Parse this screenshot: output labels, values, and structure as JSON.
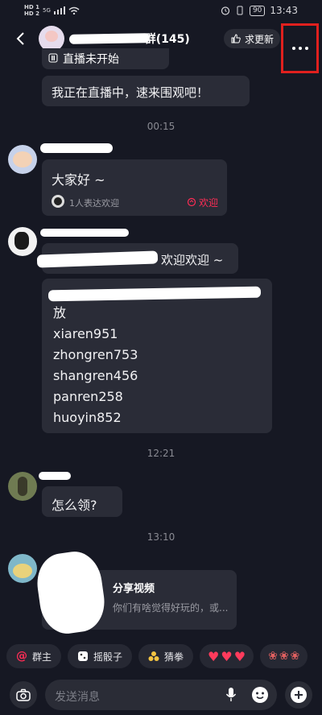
{
  "statusbar": {
    "sim1": "HD 1",
    "sim2": "HD 2",
    "net": "5G",
    "battery": "90",
    "time": "13:43"
  },
  "header": {
    "title_suffix": "1群(145)",
    "update_label": "求更新"
  },
  "messages": {
    "live_partial": "直播未开始",
    "live_msg": "我正在直播中，速来围观吧！",
    "ts1": "00:15",
    "hello": "大家好 ~",
    "reaction_count": "1人表达欢迎",
    "reaction_label": "欢迎",
    "welcome_suffix": "欢迎欢迎 ~",
    "list_first": "放",
    "list_items": [
      "xiaren951",
      "zhongren753",
      "shangren456",
      "panren258",
      "huoyin852"
    ],
    "ts2": "12:21",
    "how": "怎么领?",
    "ts3": "13:10",
    "share_title": "分享视频",
    "share_desc": "你们有啥觉得好玩的，或..."
  },
  "quick_actions": {
    "owner": "群主",
    "dice": "摇骰子",
    "rps": "猜拳"
  },
  "input": {
    "placeholder": "发送消息"
  },
  "colors": {
    "background": "#161823",
    "bubble": "#2a2c37",
    "accent_red": "#fe2c55",
    "highlight_box": "#e0201e"
  },
  "icons": [
    "back-icon",
    "thumb-up-icon",
    "more-icon",
    "camera-icon",
    "mic-icon",
    "emoji-icon",
    "plus-icon",
    "dice-icon",
    "rps-icon",
    "heart-icon",
    "flower-icon",
    "wave-hand-icon",
    "at-icon",
    "live-icon"
  ]
}
